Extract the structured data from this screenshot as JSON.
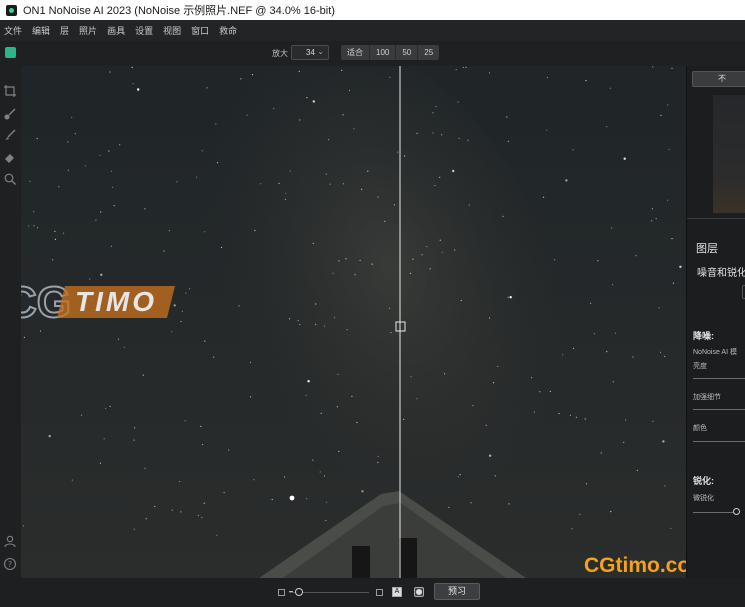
{
  "window": {
    "title": "ON1 NoNoise AI 2023 (NoNoise 示例照片.NEF @ 34.0% 16-bit)"
  },
  "menubar": {
    "items": [
      "文件",
      "编辑",
      "层",
      "照片",
      "画具",
      "设置",
      "视图",
      "窗口",
      "救命"
    ]
  },
  "toolbar": {
    "zoom_label": "放大",
    "zoom_value": "34",
    "zoom_buttons": [
      "适合",
      "100",
      "50",
      "25"
    ]
  },
  "left_tools": [
    "crop-icon",
    "brush-icon",
    "retouch-brush-icon",
    "eraser-icon",
    "zoom-tool-icon"
  ],
  "left_bottom_icons": [
    "user-icon",
    "help-icon"
  ],
  "right_panel": {
    "top_button": "不",
    "layers_title": "图层",
    "section_title": "噪音和锐化",
    "denoise_heading": "降噪:",
    "model_label": "NoNoise AI 模",
    "brightness_label": "亮度",
    "enhance_detail_label": "加强细节",
    "color_label": "颜色",
    "sharpen_heading": "锐化:",
    "micro_sharpen_label": "微锐化",
    "micro_sharpen_level": 0.9
  },
  "bottombar": {
    "preview_label": "预习",
    "zoom_slider_level": 0.08
  },
  "watermark": {
    "left_text_cg": "CG",
    "left_text_timo": "TIMO",
    "right_text": "CGtimo.com"
  },
  "colors": {
    "accent_orange": "#f5a21a",
    "app_green": "#2bb58a",
    "background": "#1e1f21"
  }
}
